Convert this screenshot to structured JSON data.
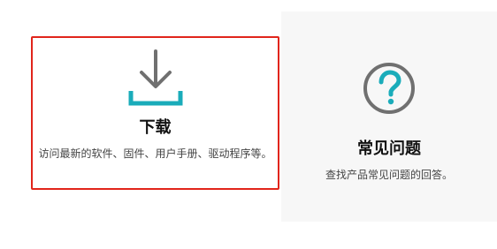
{
  "cards": [
    {
      "title": "下载",
      "description": "访问最新的软件、固件、用户手册、驱动程序等。",
      "icon": "download-icon",
      "selected": true
    },
    {
      "title": "常见问题",
      "description": "查找产品常见问题的回答。",
      "icon": "question-circle-icon",
      "selected": false
    }
  ],
  "colors": {
    "selection_border": "#e1251b",
    "accent_teal": "#1aacba",
    "icon_gray": "#707070",
    "faq_card_background": "#f7f7f7"
  }
}
